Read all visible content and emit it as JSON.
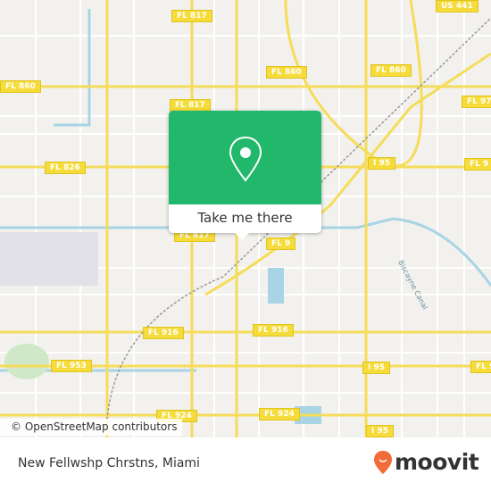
{
  "map": {
    "attribution": "© OpenStreetMap contributors",
    "canal_label": "Biscayne Canal",
    "shields": [
      {
        "label": "FL 817",
        "l": 192,
        "t": 11
      },
      {
        "label": "US 441",
        "l": 488,
        "t": 0
      },
      {
        "label": "FL 860",
        "l": 0,
        "t": 90
      },
      {
        "label": "FL 860",
        "l": 298,
        "t": 74
      },
      {
        "label": "FL 860",
        "l": 415,
        "t": 72
      },
      {
        "label": "FL 97",
        "l": 517,
        "t": 107
      },
      {
        "label": "FL 817",
        "l": 190,
        "t": 111
      },
      {
        "label": "FL 826",
        "l": 50,
        "t": 181
      },
      {
        "label": "I 95",
        "l": 412,
        "t": 176
      },
      {
        "label": "FL 9",
        "l": 520,
        "t": 177
      },
      {
        "label": "FL 817",
        "l": 195,
        "t": 257
      },
      {
        "label": "FL 9",
        "l": 298,
        "t": 266
      },
      {
        "label": "FL 916",
        "l": 160,
        "t": 366
      },
      {
        "label": "FL 916",
        "l": 283,
        "t": 363
      },
      {
        "label": "FL 953",
        "l": 57,
        "t": 403
      },
      {
        "label": "I 95",
        "l": 406,
        "t": 405
      },
      {
        "label": "FL 9",
        "l": 527,
        "t": 404
      },
      {
        "label": "FL 924",
        "l": 175,
        "t": 459
      },
      {
        "label": "FL 924",
        "l": 290,
        "t": 457
      },
      {
        "label": "I 95",
        "l": 410,
        "t": 476
      }
    ]
  },
  "popup": {
    "button_label": "Take me there",
    "color": "#21b86b"
  },
  "footer": {
    "place": "New Fellwshp Chrstns, Miami",
    "brand": "moovit",
    "brand_color": "#f26c3a"
  }
}
